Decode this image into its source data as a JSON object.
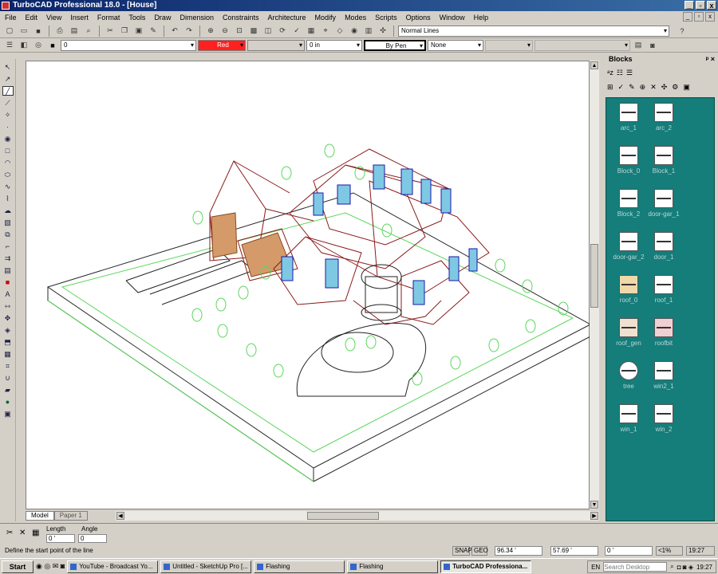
{
  "window": {
    "title": "TurboCAD Professional 18.0 - [House]",
    "minimize": "_",
    "maximize": "▫",
    "close": "x"
  },
  "menu": [
    "File",
    "Edit",
    "View",
    "Insert",
    "Format",
    "Tools",
    "Draw",
    "Dimension",
    "Constraints",
    "Architecture",
    "Modify",
    "Modes",
    "Scripts",
    "Options",
    "Window",
    "Help"
  ],
  "toolbar1": {
    "linestyle": "Normal Lines"
  },
  "toolbar2": {
    "layer": "0",
    "color": "Red",
    "thickness": "0 in",
    "pen": "By Pen",
    "fill": "None"
  },
  "blocks": {
    "title": "Blocks",
    "items": [
      "arc_1",
      "arc_2",
      "Block_0",
      "Block_1",
      "Block_2",
      "door-gar_1",
      "door-gar_2",
      "door_1",
      "roof_0",
      "roof_1",
      "roof_gen",
      "roofbit",
      "tree",
      "win2_1",
      "win_1",
      "win_2"
    ]
  },
  "tabs": {
    "model": "Model",
    "paper": "Paper 1"
  },
  "props": {
    "length_label": "Length",
    "angle_label": "Angle",
    "length_value": "0 '",
    "angle_value": "0"
  },
  "status": {
    "prompt": "Define the start point of the line",
    "snap": "SNAP",
    "geo": "GEO",
    "x": "96.34 '",
    "y": "57.69 '",
    "z": "0 '",
    "zoom": "<1%",
    "time": "19:27"
  },
  "taskbar": {
    "start": "Start",
    "tasks": [
      "YouTube - Broadcast Yo...",
      "Untitled - SketchUp Pro [...",
      "Flashing",
      "Flashing",
      "TurboCAD Professiona..."
    ],
    "lang": "EN",
    "search_placeholder": "Search Desktop",
    "clock": "19:27"
  },
  "colors": {
    "canvas_bg": "#ffffff",
    "blocks_bg": "#157d7a",
    "color_swatch": "#ff2020",
    "titlebar": "#0a246a"
  }
}
